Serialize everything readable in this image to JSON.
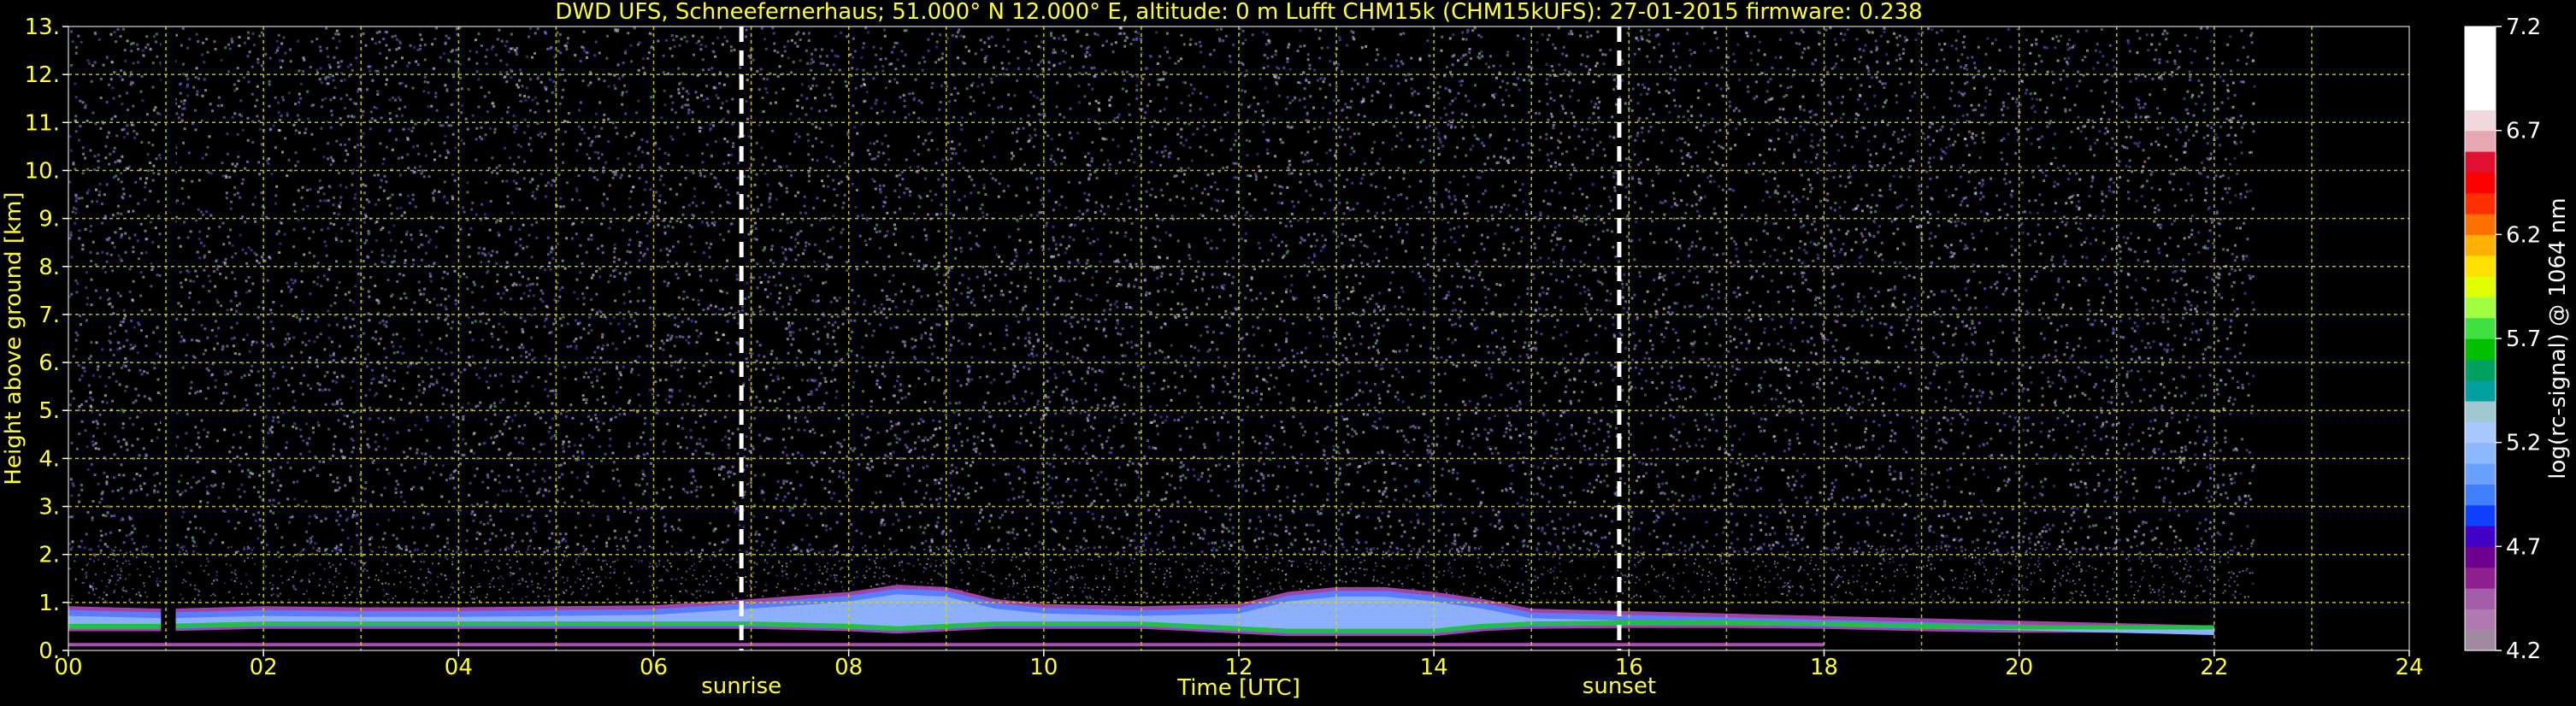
{
  "title": "DWD UFS, Schneefernerhaus; 51.000° N 12.000° E, altitude: 0 m    Lufft CHM15k (CHM15kUFS): 27-01-2015    firmware: 0.238",
  "chart_data": {
    "type": "heatmap",
    "xlabel": "Time [UTC]",
    "ylabel": "Height above ground [km]",
    "xlim": [
      0,
      24
    ],
    "ylim": [
      0,
      13
    ],
    "x_ticks": [
      "00",
      "02",
      "04",
      "06",
      "08",
      "10",
      "12",
      "14",
      "16",
      "18",
      "20",
      "22",
      "24"
    ],
    "y_ticks": [
      "0.",
      "1.",
      "2.",
      "3.",
      "4.",
      "5.",
      "6.",
      "7.",
      "8.",
      "9.",
      "10.",
      "11.",
      "12.",
      "13."
    ],
    "grid": true,
    "data_end_time": 22.4,
    "data_gap": [
      0.95,
      1.1
    ],
    "events": [
      {
        "label": "sunrise",
        "time": 6.9
      },
      {
        "label": "sunset",
        "time": 15.9
      }
    ],
    "boundary_layer": {
      "times": [
        0.0,
        1.0,
        2.0,
        3.0,
        4.0,
        5.0,
        6.0,
        7.0,
        8.0,
        8.5,
        9.0,
        9.5,
        10.0,
        11.0,
        12.0,
        12.5,
        13.0,
        13.5,
        14.0,
        14.5,
        15.0,
        16.0,
        17.0,
        18.0,
        19.0,
        20.0,
        21.0,
        22.0
      ],
      "top_km": [
        0.8,
        0.75,
        0.8,
        0.78,
        0.78,
        0.8,
        0.82,
        0.95,
        1.1,
        1.25,
        1.2,
        0.95,
        0.85,
        0.8,
        0.85,
        1.1,
        1.2,
        1.2,
        1.1,
        0.95,
        0.75,
        0.7,
        0.65,
        0.6,
        0.55,
        0.5,
        0.45,
        0.4
      ],
      "base_km": [
        0.45,
        0.45,
        0.5,
        0.5,
        0.5,
        0.5,
        0.5,
        0.5,
        0.45,
        0.4,
        0.45,
        0.5,
        0.5,
        0.5,
        0.4,
        0.35,
        0.35,
        0.35,
        0.35,
        0.45,
        0.5,
        0.52,
        0.52,
        0.5,
        0.45,
        0.42,
        0.42,
        0.42
      ]
    },
    "colorbar": {
      "label": "log(rc-signal) @ 1064 nm",
      "min": 4.2,
      "max": 7.2,
      "ticks": [
        "7.2",
        "6.7",
        "6.2",
        "5.7",
        "5.2",
        "4.7",
        "4.2"
      ],
      "colors": [
        "#a08aa0",
        "#b07ab0",
        "#a25ca8",
        "#902090",
        "#700090",
        "#4000c8",
        "#1040ff",
        "#4080ff",
        "#6aa0ff",
        "#8cb8ff",
        "#a8c8ff",
        "#a0c8d0",
        "#00a0a0",
        "#00a060",
        "#00c000",
        "#40e040",
        "#a0ff40",
        "#e0ff00",
        "#ffe000",
        "#ffb000",
        "#ff7000",
        "#ff3000",
        "#ff0000",
        "#e01030",
        "#e6a8b0",
        "#f0d8dc",
        "#ffffff",
        "#ffffff",
        "#ffffff",
        "#ffffff"
      ]
    }
  }
}
